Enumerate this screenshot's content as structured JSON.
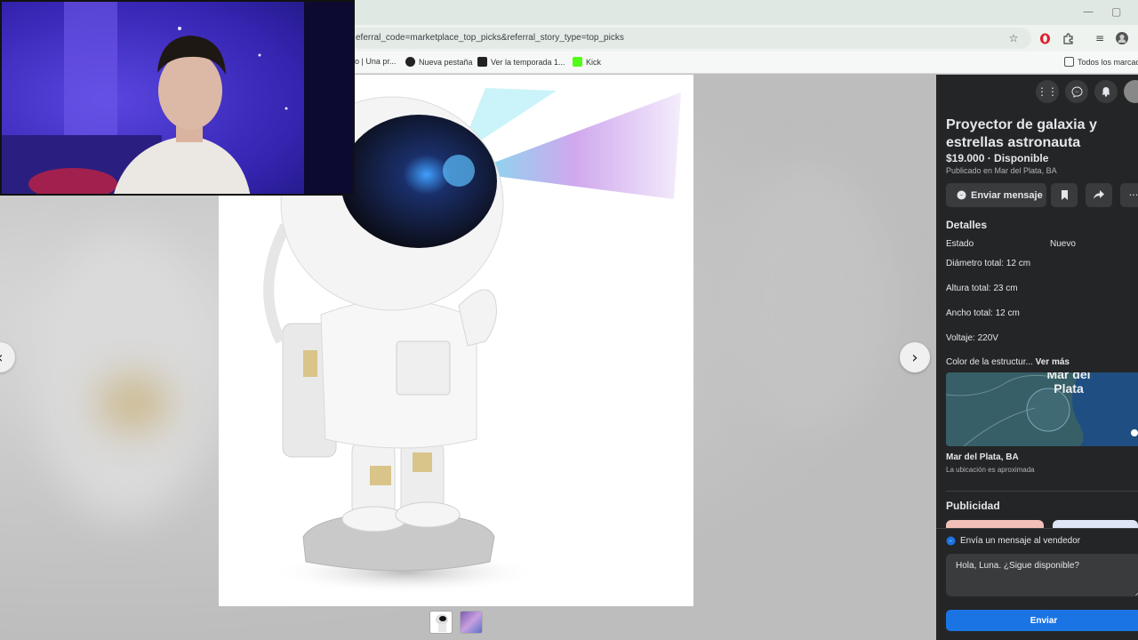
{
  "browser": {
    "url": "eferral_code=marketplace_top_picks&referral_story_type=top_picks",
    "window_controls": {
      "minimize": "—",
      "restore": "▢"
    },
    "icons": [
      "star-icon",
      "opera-icon",
      "extensions-icon",
      "media-icon",
      "profile-icon"
    ],
    "bookmarks": [
      {
        "label": "o | Una pr...",
        "icon": "page-icon"
      },
      {
        "label": "Nueva pestaña",
        "icon": "github-icon"
      },
      {
        "label": "Ver la temporada 1...",
        "icon": "play-icon"
      },
      {
        "label": "Kick",
        "icon": "kick-icon"
      }
    ],
    "all_bookmarks": "Todos los marcado"
  },
  "viewer": {
    "prev": "‹",
    "next": "›",
    "thumbnails": [
      "astronaut-thumb",
      "galaxy-thumb"
    ]
  },
  "panel": {
    "top_icons": [
      "menu-grid-icon",
      "messenger-icon",
      "bell-icon",
      "avatar"
    ],
    "title": "Proyector de galaxia y estrellas astronauta",
    "price": "$19.000 · Disponible",
    "posted": "Publicado en Mar del Plata, BA",
    "message_btn": "Enviar mensaje",
    "details_heading": "Detalles",
    "estado_label": "Estado",
    "estado_value": "Nuevo",
    "details": [
      "Diámetro total: 12 cm",
      "Altura total: 23 cm",
      "Ancho total: 12 cm",
      "Voltaje: 220V"
    ],
    "color_line": "Color de la estructur...",
    "ver_mas": "Ver más",
    "map_label": "Mar del Plata",
    "location_name": "Mar del Plata, BA",
    "location_sub": "La ubicación es aproximada",
    "ads_heading": "Publicidad",
    "send_heading": "Envía un mensaje al vendedor",
    "message_value": "Hola, Luna. ¿Sigue disponible?",
    "send_btn": "Enviar"
  },
  "colors": {
    "accent": "#1b74e4",
    "panel_bg": "#242526",
    "button_bg": "#3a3b3c"
  }
}
